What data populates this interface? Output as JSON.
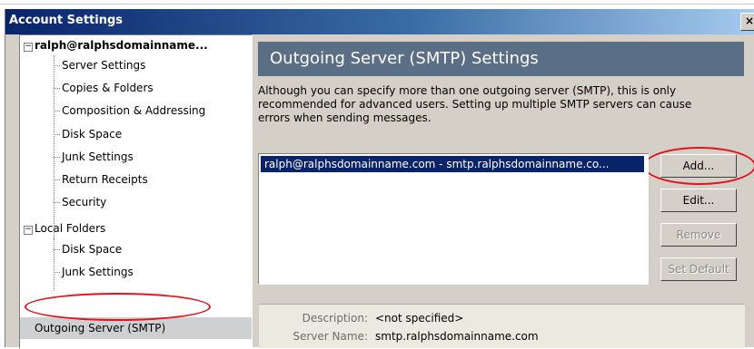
{
  "window": {
    "title": "Account Settings",
    "close_label": "×"
  },
  "tree": {
    "account": "ralph@ralphsdomainname...",
    "account_children": [
      "Server Settings",
      "Copies & Folders",
      "Composition & Addressing",
      "Disk Space",
      "Junk Settings",
      "Return Receipts",
      "Security"
    ],
    "local_folders": "Local Folders",
    "local_children": [
      "Disk Space",
      "Junk Settings"
    ],
    "outgoing": "Outgoing Server (SMTP)",
    "collapse_glyph": "−"
  },
  "panel": {
    "heading": "Outgoing Server (SMTP) Settings",
    "description": [
      "Although you can specify more than one outgoing server (SMTP), this is only",
      "recommended for advanced users. Setting up multiple SMTP servers can cause",
      "errors when sending messages."
    ],
    "servers": [
      "ralph@ralphsdomainname.com - smtp.ralphsdomainname.co..."
    ],
    "buttons": {
      "add": "Add...",
      "edit": "Edit...",
      "remove": "Remove",
      "set_default": "Set Default"
    },
    "details": {
      "description_label": "Description:",
      "description_value": "<not specified>",
      "server_label": "Server Name:",
      "server_value": "smtp.ralphsdomainname.com"
    }
  },
  "colors": {
    "header_bg": "#5a6e85",
    "selection": "#0a246a",
    "annotation": "#e0141c"
  }
}
